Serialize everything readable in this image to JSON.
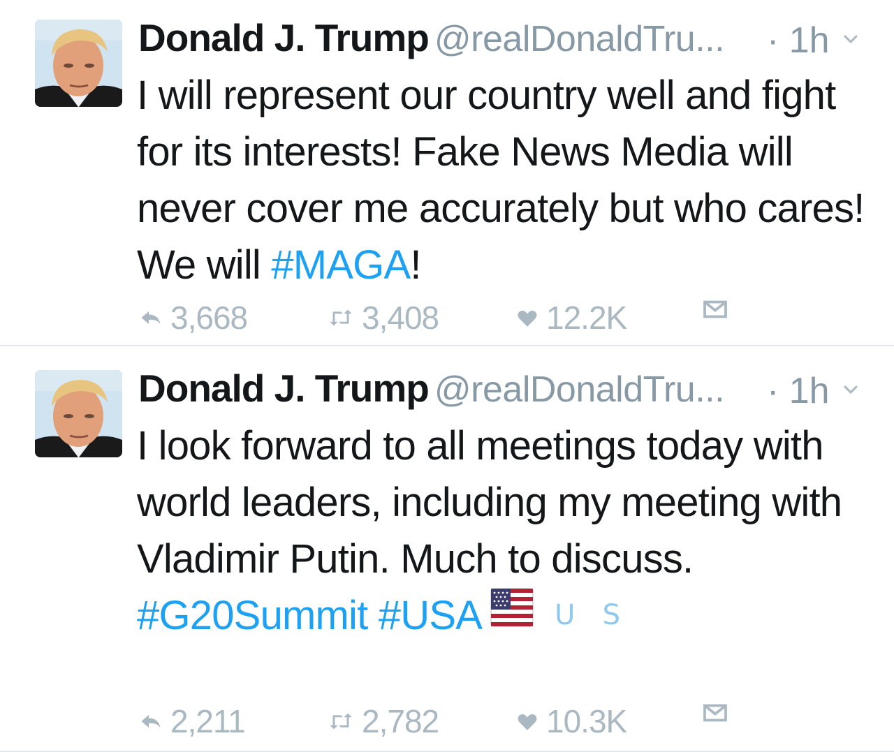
{
  "tweets": [
    {
      "author": {
        "name": "Donald J. Trump",
        "handle": "@realDonaldTru...",
        "avatar_icon": "profile-photo"
      },
      "time": "· 1h",
      "text_before": "I will represent our country well and fight for its interests! Fake News Media will never cover me accurately but who cares! We will ",
      "hashtag": "#MAGA",
      "text_after": "!",
      "stats": {
        "replies": "3,668",
        "retweets": "3,408",
        "likes": "12.2K"
      }
    },
    {
      "author": {
        "name": "Donald J. Trump",
        "handle": "@realDonaldTru...",
        "avatar_icon": "profile-photo"
      },
      "time": "· 1h",
      "text": "I look forward to all meetings today with world leaders, including my meeting with Vladimir Putin. Much to discuss.",
      "hashtags": [
        "#G20Summit",
        "#USA"
      ],
      "emoji": "us-flag-icon",
      "regional_letters": [
        "U",
        "S"
      ],
      "stats": {
        "replies": "2,211",
        "retweets": "2,782",
        "likes": "10.3K"
      }
    }
  ],
  "colors": {
    "link": "#1da1f2",
    "muted": "#8899a6",
    "action": "#aab8c2",
    "text": "#14171a",
    "divider": "#e1e8ed"
  }
}
